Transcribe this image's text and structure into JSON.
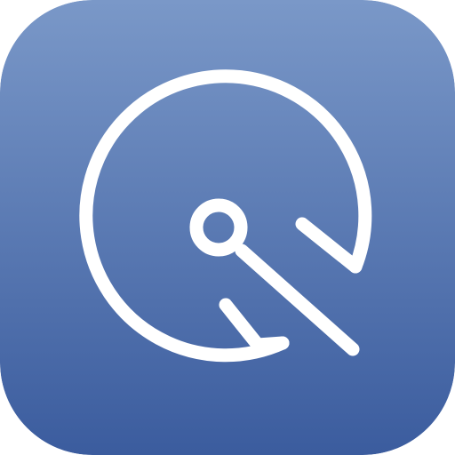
{
  "icon": {
    "name": "app-icon",
    "glyph": "abstract-circle-key-icon",
    "colors": {
      "gradient_top": "#7A98C8",
      "gradient_bottom": "#3B5C9E",
      "glyph_stroke": "#FFFFFF"
    }
  }
}
